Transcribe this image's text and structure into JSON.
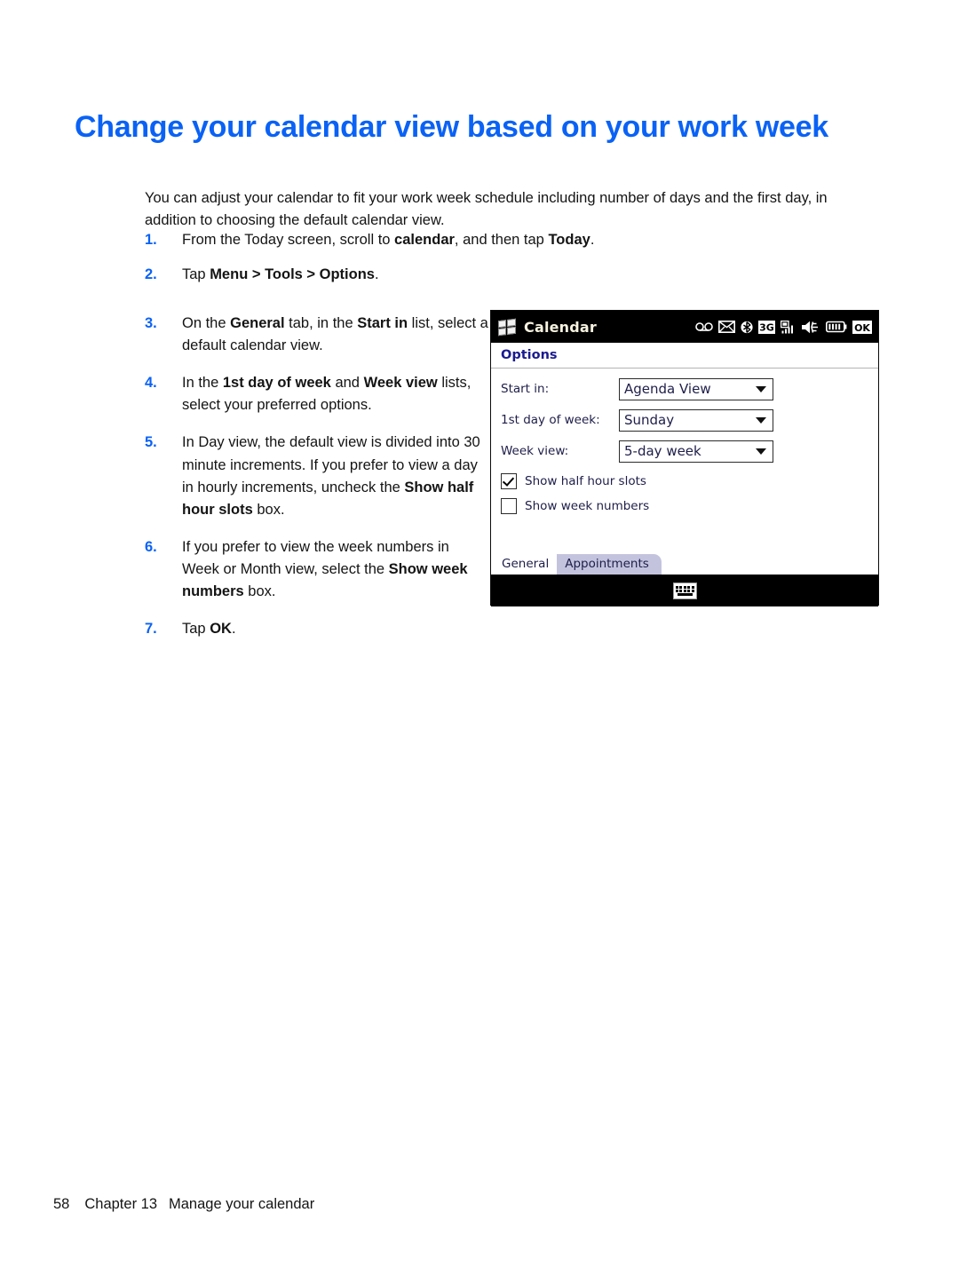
{
  "page": {
    "heading": "Change your calendar view based on your work week",
    "intro": "You can adjust your calendar to fit your work week schedule including number of days and the first day, in addition to choosing the default calendar view.",
    "heading_color": "#0a62f5"
  },
  "steps": [
    {
      "num": "1.",
      "text": "From the Today screen, scroll to calendar, and then tap Today."
    },
    {
      "num": "2.",
      "text": "Tap Menu > Tools > Options."
    },
    {
      "num": "3.",
      "text": "On the General tab, in the Start in list, select a default calendar view."
    },
    {
      "num": "4.",
      "text": "In the 1st day of week and Week view lists, select your preferred options."
    },
    {
      "num": "5.",
      "text": "In Day view, the default view is divided into 30 minute increments. If you prefer to view a day in hourly increments, uncheck the Show half hour slots box."
    },
    {
      "num": "6.",
      "text": "If you prefer to view the week numbers in Week or Month view, select the Show week numbers box."
    },
    {
      "num": "7.",
      "text": "Tap OK."
    }
  ],
  "device": {
    "title": "Calendar",
    "page_header": "Options",
    "status_icons": [
      "voicemail-icon",
      "message-envelope-icon",
      "bluetooth-icon",
      "3g-icon",
      "signal-bars-icon",
      "speaker-volume-icon",
      "battery-icon",
      "ok-button-icon"
    ],
    "ok_label": "OK",
    "threeg_label": "3G",
    "fields": [
      {
        "label": "Start in:",
        "value": "Agenda View"
      },
      {
        "label": "1st day of week:",
        "value": "Sunday"
      },
      {
        "label": "Week view:",
        "value": "5-day week"
      }
    ],
    "checkboxes": [
      {
        "label": "Show half hour slots",
        "checked": true
      },
      {
        "label": "Show week numbers",
        "checked": false
      }
    ],
    "tabs": [
      {
        "label": "General",
        "active": true
      },
      {
        "label": "Appointments",
        "active": false
      }
    ],
    "sip_icon": "keyboard-icon"
  },
  "footer": {
    "page_number": "58",
    "chapter": "Chapter 13",
    "chapter_title": "Manage your calendar"
  }
}
